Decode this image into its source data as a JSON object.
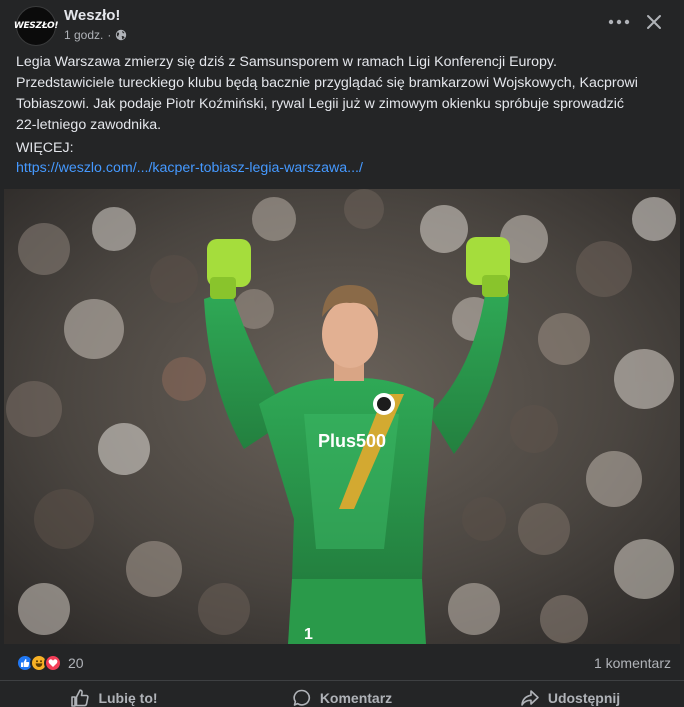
{
  "header": {
    "page_name": "Weszło!",
    "avatar_text": "WESZŁO!",
    "time": "1 godz.",
    "separator": "·"
  },
  "post": {
    "lines": [
      "Legia Warszawa zmierzy się dziś z Samsunsporem w ramach Ligi Konferencji Europy.",
      "Przedstawiciele tureckiego klubu będą bacznie przyglądać się bramkarzowi Wojskowych, Kacprowi",
      "Tobiaszowi. Jak podaje Piotr Koźmiński, rywal Legii już w zimowym okienku spróbuje sprowadzić",
      "22-letniego zawodnika."
    ],
    "more_label": "WIĘCEJ:",
    "link_text": "https://weszlo.com/.../kacper-tobiasz-legia-warszawa.../"
  },
  "photo": {
    "jersey_sponsor": "Plus500",
    "jersey_number": "1",
    "colors": {
      "jersey": "#2f9e50",
      "gloves": "#9fdc3a",
      "background": "#4a4540"
    }
  },
  "footer": {
    "reactions": [
      "like",
      "haha",
      "love"
    ],
    "reaction_count": "20",
    "comments": "1 komentarz",
    "actions": {
      "like": "Lubię to!",
      "comment": "Komentarz",
      "share": "Udostępnij"
    }
  },
  "colors": {
    "card_bg": "#242526",
    "text_primary": "#e4e6eb",
    "text_secondary": "#b0b3b8",
    "link": "#4599ff",
    "like_blue": "#2078f4"
  }
}
